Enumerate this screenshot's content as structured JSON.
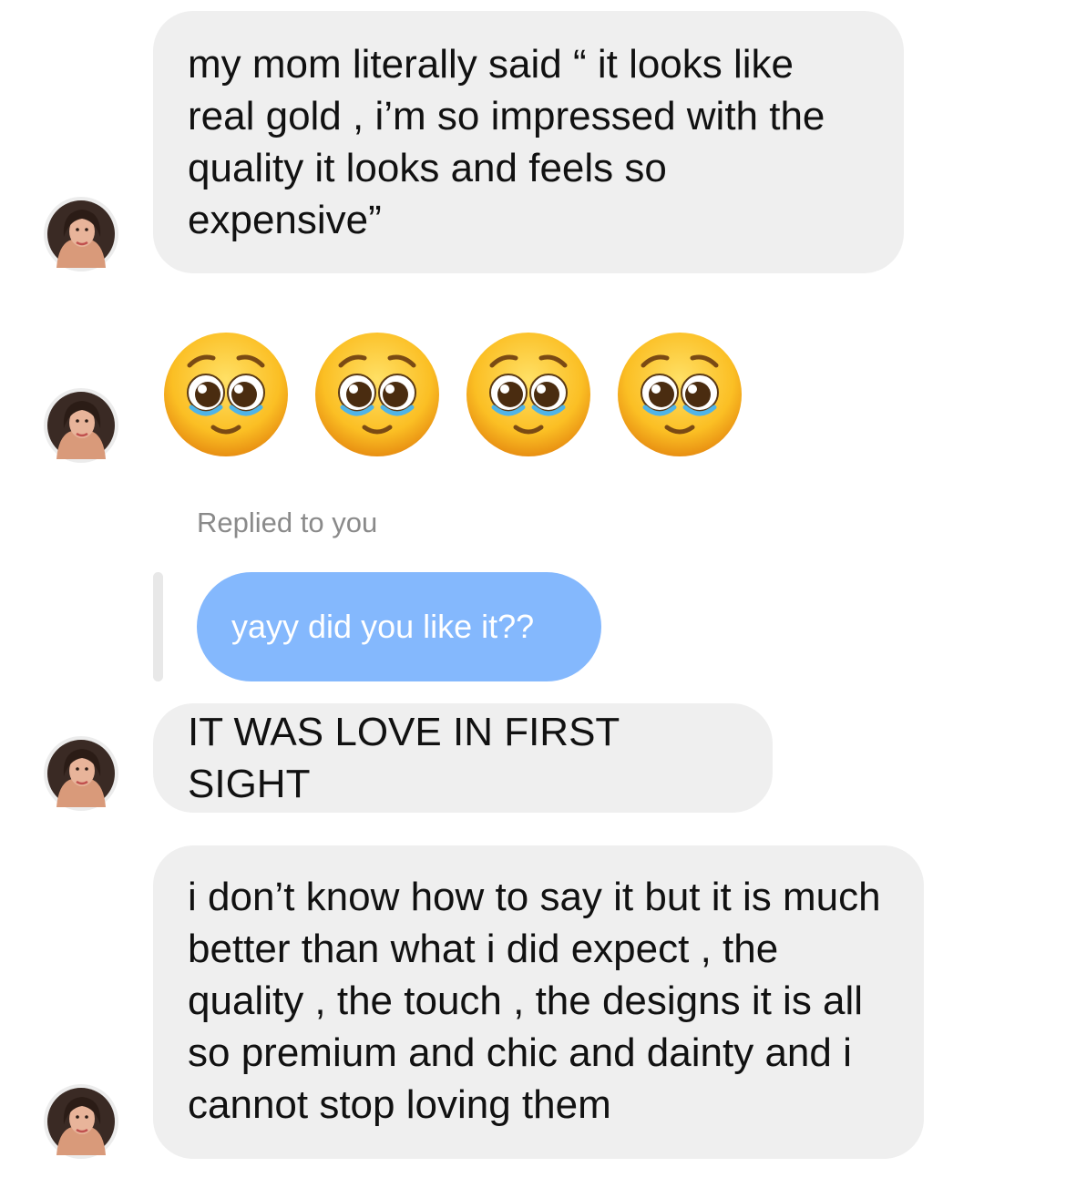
{
  "messages": [
    {
      "type": "text",
      "text": "my mom literally said “ it looks like real gold , i’m so impressed with the quality it looks and feels so expensive”"
    },
    {
      "type": "emoji",
      "emojis": [
        "pleading-face",
        "pleading-face",
        "pleading-face",
        "pleading-face"
      ]
    },
    {
      "type": "reply",
      "note": "Replied to you",
      "quoted_text": "yayy did you like it??",
      "quoted_color": "#84b8fd"
    },
    {
      "type": "text",
      "text": "IT WAS LOVE IN FIRST SIGHT"
    },
    {
      "type": "text",
      "text": "i don’t know how to say it but it is much better than what i did expect , the quality , the touch , the designs it is all so premium and chic and dainty and i cannot stop loving them"
    }
  ],
  "colors": {
    "incoming_bubble": "#efefef",
    "reply_bubble": "#84b8fd",
    "background": "#ffffff"
  }
}
